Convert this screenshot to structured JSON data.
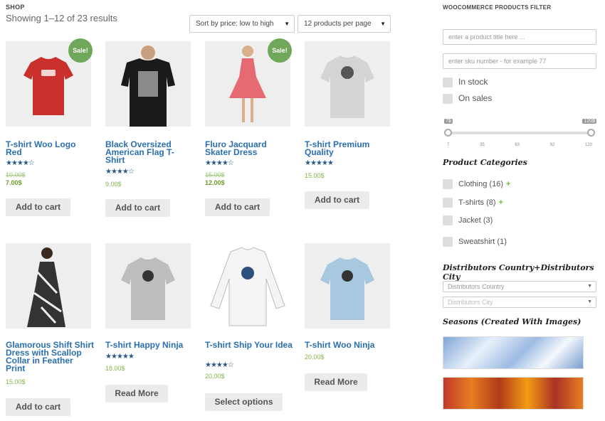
{
  "header": {
    "shop_label": "SHOP",
    "results_text": "Showing 1–12 of 23 results",
    "sort_select": "Sort by price: low to high",
    "per_page_select": "12 products per page"
  },
  "products": [
    {
      "title": "T-shirt Woo Logo Red",
      "stars": "★★★★☆",
      "price_old": "10.00$",
      "price_new": "7.00$",
      "sale": "Sale!",
      "button": "Add to cart"
    },
    {
      "title": "Black Oversized American Flag T-Shirt",
      "stars": "★★★★☆",
      "price": "9.00$",
      "button": "Add to cart"
    },
    {
      "title": "Fluro Jacquard Skater Dress",
      "stars": "★★★★☆",
      "price_old": "15.00$",
      "price_new": "12.00$",
      "sale": "Sale!",
      "button": "Add to cart"
    },
    {
      "title": "T-shirt Premium Quality",
      "stars": "★★★★★",
      "price": "15.00$",
      "button": "Add to cart"
    },
    {
      "title": "Glamorous Shift Shirt Dress with Scallop Collar in Feather Print",
      "price": "15.00$",
      "button": "Add to cart"
    },
    {
      "title": "T-shirt Happy Ninja",
      "stars": "★★★★★",
      "price": "18.00$",
      "button": "Read More"
    },
    {
      "title": "T-shirt Ship Your Idea",
      "stars": "★★★★☆",
      "price": "20.00$",
      "button": "Select options"
    },
    {
      "title": "T-shirt Woo Ninja",
      "price": "20.00$",
      "button": "Read More"
    }
  ],
  "sidebar": {
    "title": "WOOCOMMERCE PRODUCTS FILTER",
    "title_placeholder": "enter a product title here ...",
    "sku_placeholder": "enter sku number - for example 77",
    "in_stock": "In stock",
    "on_sales": "On sales",
    "slider_min": "7$",
    "slider_max": "120$",
    "slider_ticks": [
      "7",
      "35",
      "63",
      "92",
      "120"
    ],
    "categories_heading": "Product Categories",
    "categories": [
      "Clothing (16)",
      "T-shirts (8)",
      "Jacket (3)",
      "Sweatshirt (1)"
    ],
    "distributors_heading": "Distributors Country+Distributors City",
    "country_placeholder": "Distributors Country",
    "city_placeholder": "Distributors City",
    "seasons_heading": "Seasons (Created With Images)"
  },
  "colors": {
    "link": "#2a6fb0",
    "sale_badge": "#6fa85a",
    "price": "#82b54b"
  }
}
